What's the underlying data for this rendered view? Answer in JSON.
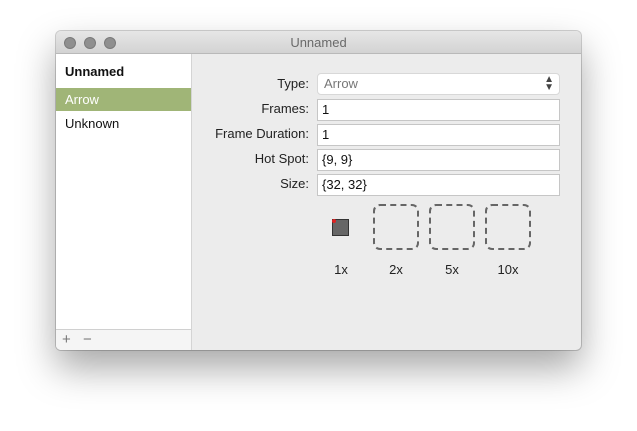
{
  "window": {
    "title": "Unnamed"
  },
  "sidebar": {
    "header": "Unnamed",
    "items": [
      {
        "label": "Arrow",
        "selected": true
      },
      {
        "label": "Unknown",
        "selected": false
      }
    ],
    "footer": {
      "add_label": "+",
      "remove_label": "−"
    }
  },
  "form": {
    "type": {
      "label": "Type:",
      "value": "Arrow"
    },
    "frames": {
      "label": "Frames:",
      "value": "1"
    },
    "frame_duration": {
      "label": "Frame Duration:",
      "value": "1"
    },
    "hot_spot": {
      "label": "Hot Spot:",
      "value": "{9, 9}"
    },
    "size": {
      "label": "Size:",
      "value": "{32, 32}"
    }
  },
  "previews": [
    {
      "label": "1x"
    },
    {
      "label": "2x"
    },
    {
      "label": "5x"
    },
    {
      "label": "10x"
    }
  ],
  "colors": {
    "selection": "#a0b577",
    "window_bg": "#ececec"
  }
}
